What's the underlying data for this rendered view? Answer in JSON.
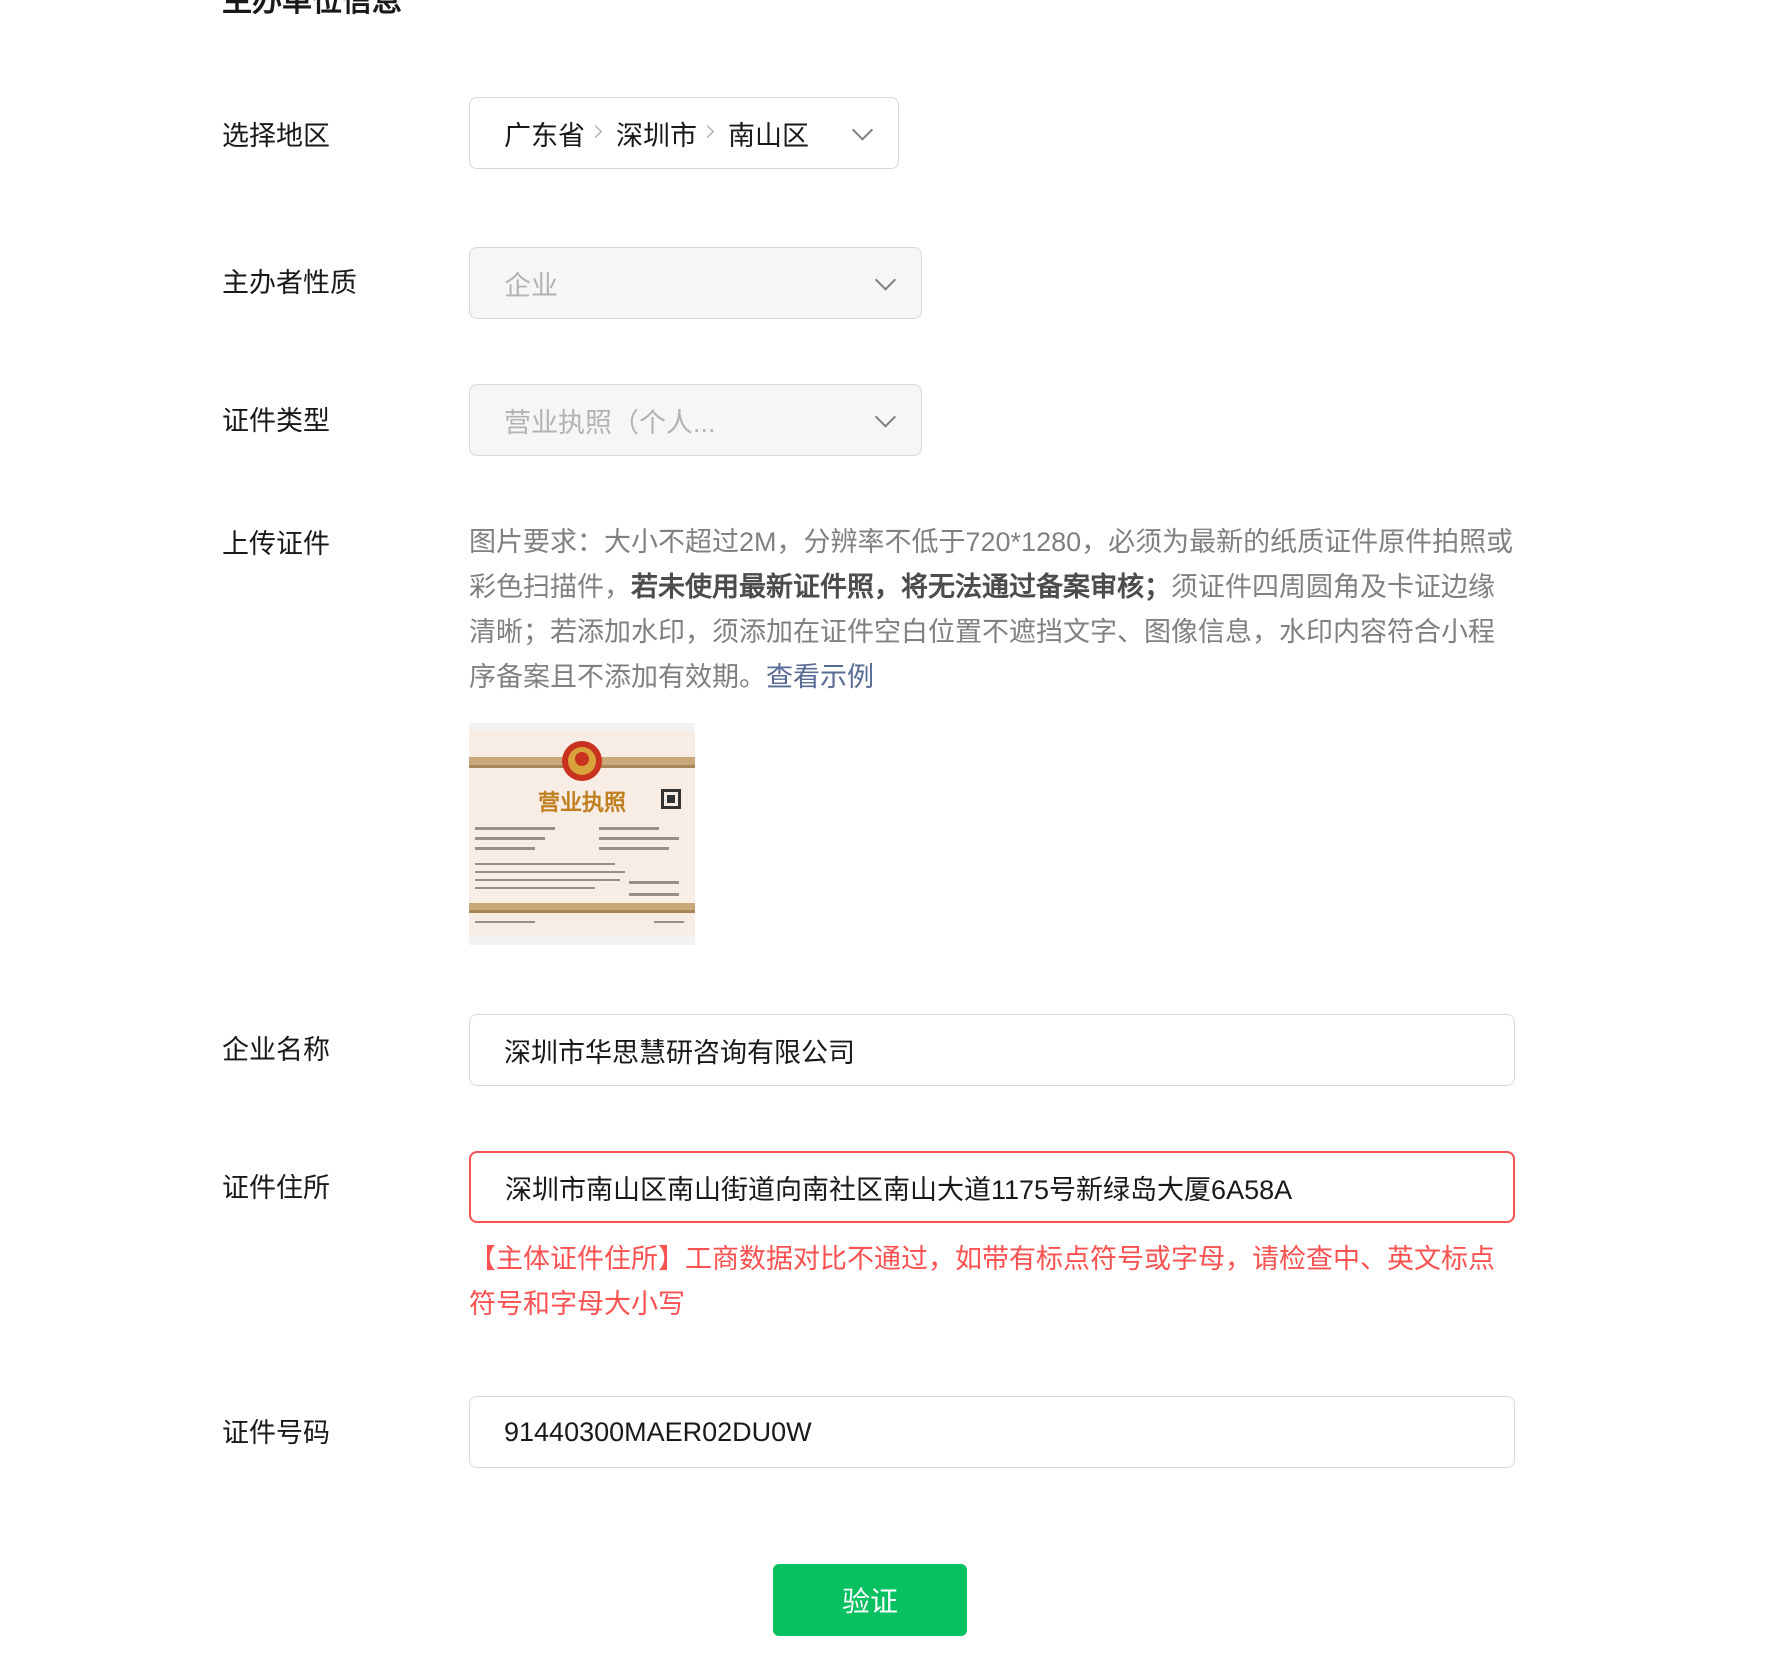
{
  "section_title": "主办单位信息",
  "region": {
    "label": "选择地区",
    "province": "广东省",
    "city": "深圳市",
    "district": "南山区"
  },
  "organizer_type": {
    "label": "主办者性质",
    "value": "企业"
  },
  "cert_type": {
    "label": "证件类型",
    "value": "营业执照（个人..."
  },
  "upload": {
    "label": "上传证件",
    "desc_1": "图片要求：大小不超过2M，分辨率不低于720*1280，必须为最新的纸质证件原件拍照或彩色扫描件，",
    "desc_bold": "若未使用最新证件照，将无法通过备案审核；",
    "desc_2": "须证件四周圆角及卡证边缘清晰；若添加水印，须添加在证件空白位置不遮挡文字、图像信息，水印内容符合小程序备案且不添加有效期。",
    "example_link": "查看示例",
    "license_title": "营业执照"
  },
  "company_name": {
    "label": "企业名称",
    "value": "深圳市华思慧研咨询有限公司"
  },
  "cert_address": {
    "label": "证件住所",
    "value": "深圳市南山区南山街道向南社区南山大道1175号新绿岛大厦6A58A",
    "error": "【主体证件住所】工商数据对比不通过，如带有标点符号或字母，请检查中、英文标点符号和字母大小写"
  },
  "cert_number": {
    "label": "证件号码",
    "value": "91440300MAER02DU0W"
  },
  "verify_button": "验证",
  "colors": {
    "primary": "#07c160",
    "error": "#fa5151",
    "link": "#576b95"
  }
}
